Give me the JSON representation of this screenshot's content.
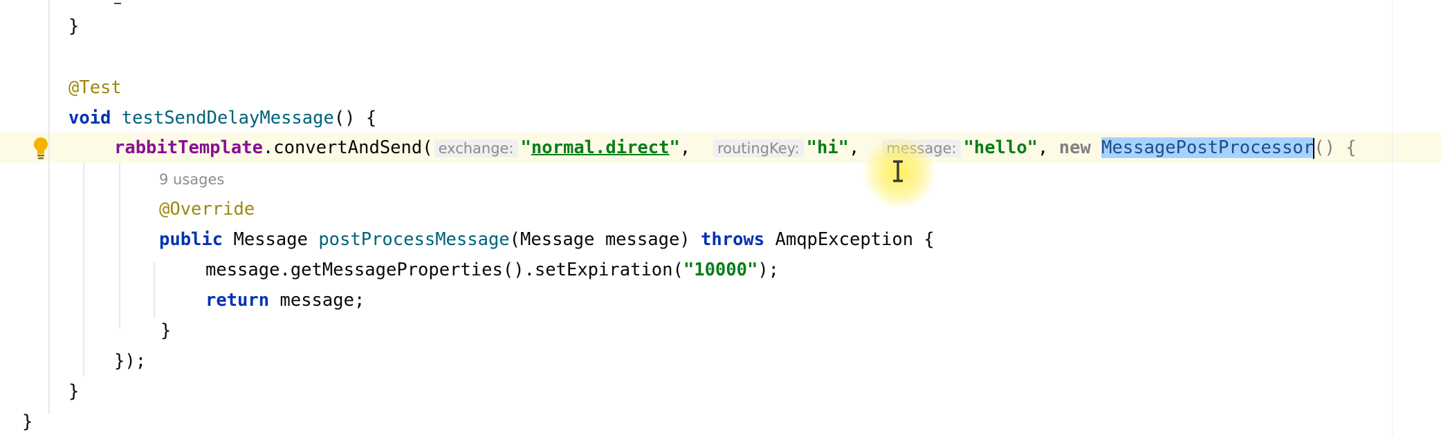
{
  "code": {
    "line0_brace": "}",
    "line1_annotation": "@Test",
    "line2_void": "void",
    "line2_method": "testSendDelayMessage",
    "line2_rest": "() {",
    "line3_field": "rabbitTemplate",
    "line3_call": ".convertAndSend(",
    "line3_hint_exchange": "exchange:",
    "line3_str_open1": "\"",
    "line3_str_exchange": "normal.direct",
    "line3_str_close1": "\"",
    "line3_comma1": ",",
    "line3_hint_routing": "routingKey:",
    "line3_str_routing": "\"hi\"",
    "line3_comma2": ",",
    "line3_hint_message": "message:",
    "line3_str_message": "\"hello\"",
    "line3_comma3": ",",
    "line3_new": "new",
    "line3_class": "MessagePostProcessor",
    "line3_tail": "() {",
    "line4_usages": "9 usages",
    "line5_annotation": "@Override",
    "line6_public": "public",
    "line6_type": "Message",
    "line6_method": "postProcessMessage",
    "line6_params": "(Message message)",
    "line6_throws": "throws",
    "line6_exception": "AmqpException {",
    "line7_call": "message.getMessageProperties().setExpiration(",
    "line7_str": "\"10000\"",
    "line7_end": ");",
    "line8_return": "return",
    "line8_rest": "message;",
    "line9_brace": "}",
    "line10_close": "});",
    "line11_brace": "}",
    "line12_brace": "}"
  },
  "icons": {
    "intention": "lightbulb-icon",
    "cursor": "text-cursor-icon"
  },
  "colors": {
    "keyword": "#0033b3",
    "annotation": "#9e880d",
    "string": "#067d17",
    "field": "#871094",
    "selection": "#a6d2ff",
    "current_line": "#fdfbe6"
  }
}
